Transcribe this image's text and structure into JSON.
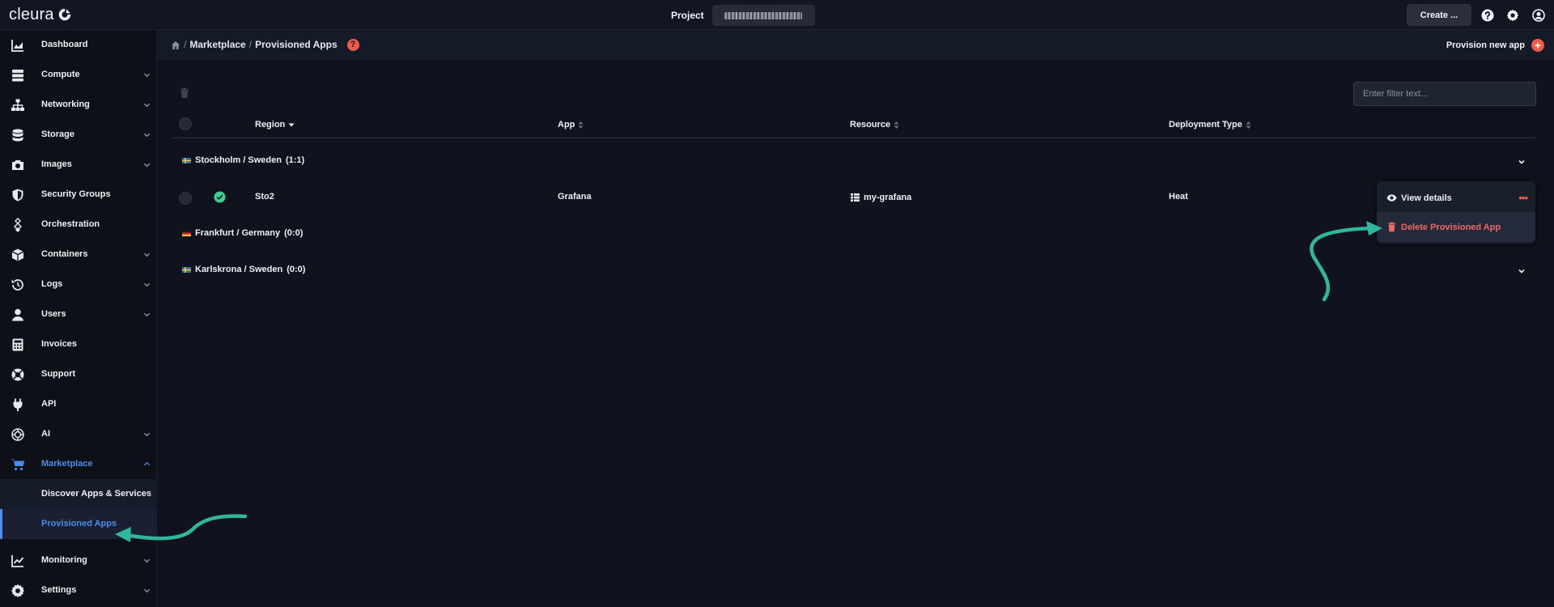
{
  "app": {
    "logo_text": "cleura",
    "project_label": "Project",
    "create_label": "Create ..."
  },
  "sidebar": {
    "items": [
      {
        "label": "Dashboard",
        "icon": "chart-area-icon",
        "chevron": false
      },
      {
        "label": "Compute",
        "icon": "server-icon",
        "chevron": true
      },
      {
        "label": "Networking",
        "icon": "network-icon",
        "chevron": true
      },
      {
        "label": "Storage",
        "icon": "database-icon",
        "chevron": true
      },
      {
        "label": "Images",
        "icon": "camera-icon",
        "chevron": true
      },
      {
        "label": "Security Groups",
        "icon": "shield-icon",
        "chevron": false
      },
      {
        "label": "Orchestration",
        "icon": "orchestration-icon",
        "chevron": false
      },
      {
        "label": "Containers",
        "icon": "cube-icon",
        "chevron": true
      },
      {
        "label": "Logs",
        "icon": "history-icon",
        "chevron": true
      },
      {
        "label": "Users",
        "icon": "user-icon",
        "chevron": true
      },
      {
        "label": "Invoices",
        "icon": "calculator-icon",
        "chevron": false
      },
      {
        "label": "Support",
        "icon": "lifebuoy-icon",
        "chevron": false
      },
      {
        "label": "API",
        "icon": "plug-icon",
        "chevron": false
      },
      {
        "label": "AI",
        "icon": "ai-icon",
        "chevron": true
      },
      {
        "label": "Marketplace",
        "icon": "cart-icon",
        "chevron": true,
        "active": true
      }
    ],
    "marketplace_sub": [
      {
        "label": "Discover Apps & Services"
      },
      {
        "label": "Provisioned Apps",
        "active": true
      }
    ],
    "bottom_items": [
      {
        "label": "Monitoring",
        "icon": "chart-line-icon",
        "chevron": true
      },
      {
        "label": "Settings",
        "icon": "gear-icon",
        "chevron": true
      }
    ]
  },
  "breadcrumb": {
    "sep": "/",
    "parent": "Marketplace",
    "current": "Provisioned Apps",
    "help": "?"
  },
  "header_actions": {
    "provision_label": "Provision new app",
    "plus": "+"
  },
  "filter": {
    "placeholder": "Enter filter text..."
  },
  "table": {
    "columns": [
      {
        "label": "Region"
      },
      {
        "label": "App"
      },
      {
        "label": "Resource"
      },
      {
        "label": "Deployment Type"
      }
    ],
    "groups": [
      {
        "label": "Stockholm / Sweden",
        "count": "(1:1)"
      },
      {
        "label": "Frankfurt / Germany",
        "count": "(0:0)"
      },
      {
        "label": "Karlskrona / Sweden",
        "count": "(0:0)"
      }
    ],
    "row": {
      "region": "Sto2",
      "app": "Grafana",
      "resource": "my-grafana",
      "deployment": "Heat"
    }
  },
  "context_menu": {
    "view_label": "View details",
    "delete_label": "Delete Provisioned App",
    "dots": "•••"
  },
  "colors": {
    "accent": "#4a8de8",
    "danger": "#ef5a4b",
    "success": "#3ecf8e",
    "annotation": "#2fb79d"
  }
}
